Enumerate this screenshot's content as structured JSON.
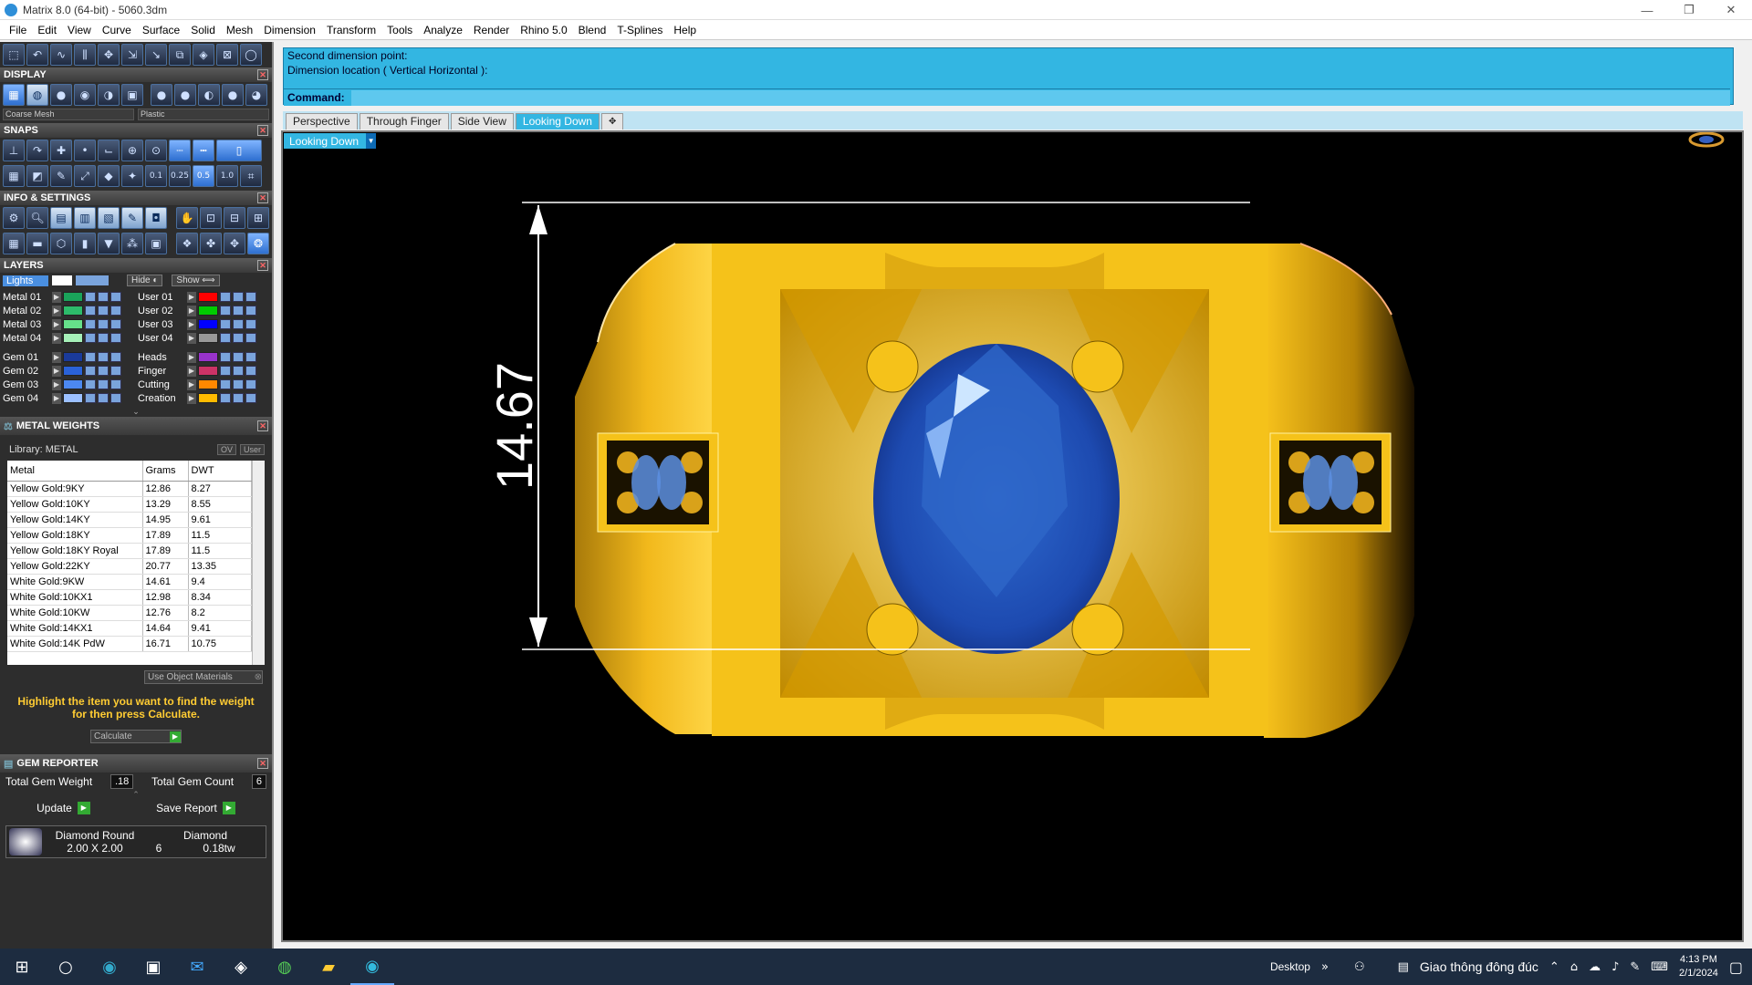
{
  "window": {
    "title": "Matrix 8.0 (64-bit) - 5060.3dm",
    "controls": [
      "—",
      "❐",
      "✕"
    ]
  },
  "menu": [
    "File",
    "Edit",
    "View",
    "Curve",
    "Surface",
    "Solid",
    "Mesh",
    "Dimension",
    "Transform",
    "Tools",
    "Analyze",
    "Render",
    "Rhino 5.0",
    "Blend",
    "T-Splines",
    "Help"
  ],
  "left": {
    "display": {
      "title": "DISPLAY",
      "mesh_select": "Coarse Mesh",
      "material_select": "Plastic"
    },
    "snaps": {
      "title": "SNAPS",
      "values": [
        "0.1",
        "0.25",
        "0.5",
        "1.0"
      ]
    },
    "info": {
      "title": "INFO & SETTINGS"
    },
    "layers": {
      "title": "LAYERS",
      "lights": "Lights",
      "hide": "Hide",
      "show": "Show",
      "left": [
        {
          "name": "Metal 01",
          "color": "#1aa35a"
        },
        {
          "name": "Metal 02",
          "color": "#2dbb6a"
        },
        {
          "name": "Metal 03",
          "color": "#66e08a"
        },
        {
          "name": "Metal 04",
          "color": "#a6f0b8"
        },
        {
          "name": "Gem 01",
          "color": "#1a3a9a"
        },
        {
          "name": "Gem 02",
          "color": "#2a62d8"
        },
        {
          "name": "Gem 03",
          "color": "#4c88f0"
        },
        {
          "name": "Gem 04",
          "color": "#9cc0ff"
        }
      ],
      "right": [
        {
          "name": "User 01",
          "color": "#ff0000"
        },
        {
          "name": "User 02",
          "color": "#00cc00"
        },
        {
          "name": "User 03",
          "color": "#0000ff"
        },
        {
          "name": "User 04",
          "color": "#999999"
        },
        {
          "name": "Heads",
          "color": "#9933cc"
        },
        {
          "name": "Finger",
          "color": "#cc3366"
        },
        {
          "name": "Cutting",
          "color": "#ff8800"
        },
        {
          "name": "Creation",
          "color": "#ffbb00"
        }
      ]
    },
    "metal_weights": {
      "title": "METAL WEIGHTS",
      "library": "Library: METAL",
      "toggles": [
        "OV",
        "User"
      ],
      "headers": [
        "Metal",
        "Grams",
        "DWT"
      ],
      "rows": [
        [
          "Yellow Gold:9KY",
          "12.86",
          "8.27"
        ],
        [
          "Yellow Gold:10KY",
          "13.29",
          "8.55"
        ],
        [
          "Yellow Gold:14KY",
          "14.95",
          "9.61"
        ],
        [
          "Yellow Gold:18KY",
          "17.89",
          "11.5"
        ],
        [
          "Yellow Gold:18KY Royal",
          "17.89",
          "11.5"
        ],
        [
          "Yellow Gold:22KY",
          "20.77",
          "13.35"
        ],
        [
          "White Gold:9KW",
          "14.61",
          "9.4"
        ],
        [
          "White Gold:10KX1",
          "12.98",
          "8.34"
        ],
        [
          "White Gold:10KW",
          "12.76",
          "8.2"
        ],
        [
          "White Gold:14KX1",
          "14.64",
          "9.41"
        ],
        [
          "White Gold:14K PdW",
          "16.71",
          "10.75"
        ]
      ],
      "use_object": "Use Object Materials",
      "hint": "Highlight the item you want to find the weight for then press Calculate.",
      "calculate": "Calculate"
    },
    "gem_reporter": {
      "title": "GEM REPORTER",
      "total_weight_label": "Total Gem Weight",
      "total_weight": ".18",
      "total_count_label": "Total Gem Count",
      "total_count": "6",
      "update": "Update",
      "save": "Save Report",
      "gem": {
        "shape": "Diamond Round",
        "type": "Diamond",
        "size": "2.00 X 2.00",
        "count": "6",
        "weight": "0.18tw"
      }
    }
  },
  "command": {
    "line1": "Second dimension point:",
    "line2": "Dimension location ( Vertical  Horizontal ):",
    "label": "Command:"
  },
  "tabs": [
    "Perspective",
    "Through Finger",
    "Side View",
    "Looking Down"
  ],
  "active_tab": "Looking Down",
  "viewport": {
    "label": "Looking Down",
    "dimension": "14.67"
  },
  "taskbar": {
    "desktop": "Desktop",
    "news": "Giao thông đông đúc",
    "time": "4:13 PM",
    "date": "2/1/2024"
  },
  "colors": {
    "accent": "#33b6e2",
    "gold": "#f5c21a",
    "sapphire": "#1f4fb8"
  }
}
